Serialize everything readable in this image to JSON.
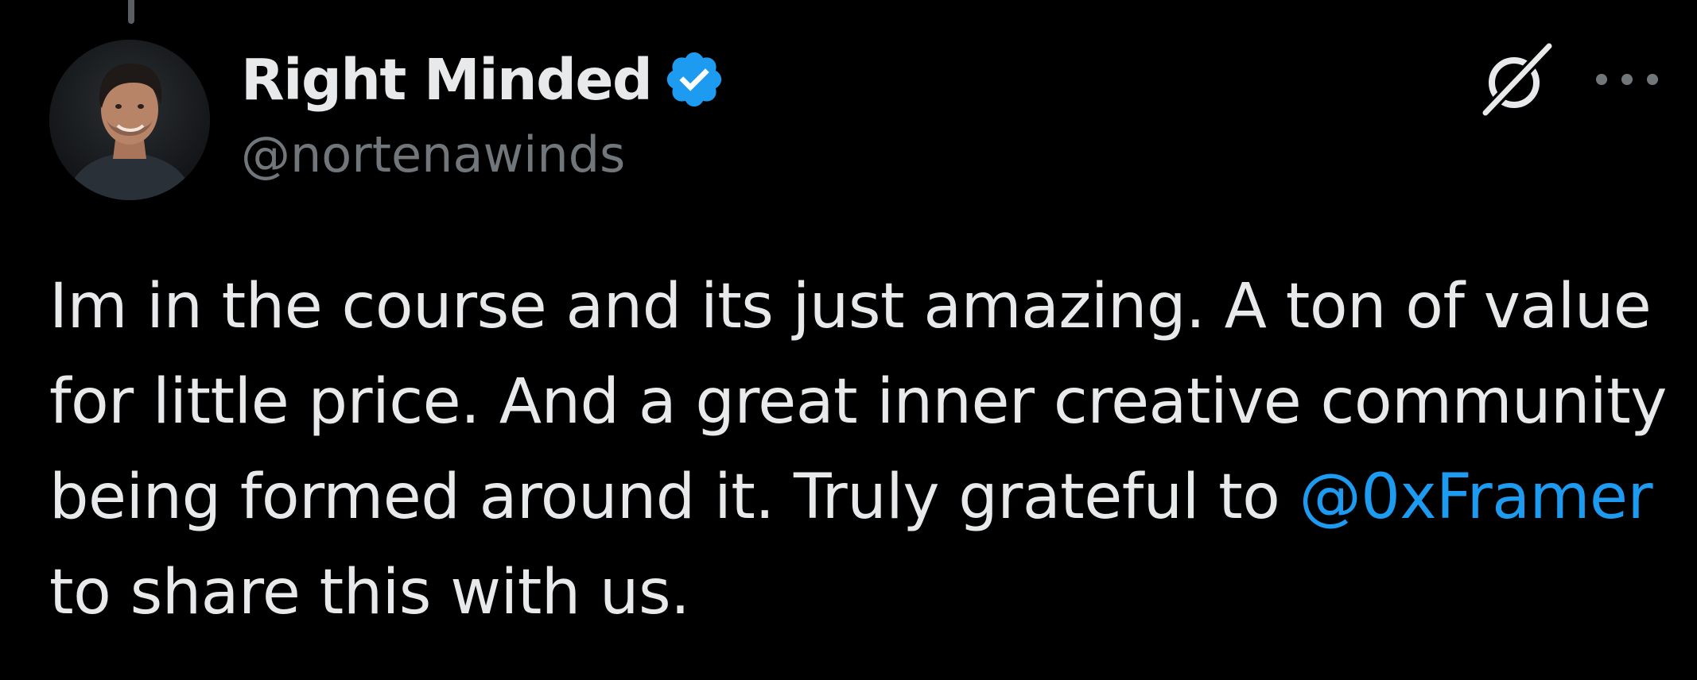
{
  "author": {
    "display_name": "Right Minded",
    "handle": "@nortenawinds",
    "verified": true,
    "verified_badge_color": "#1d9bf0"
  },
  "actions": {
    "grok_icon": "grok-icon",
    "more_icon": "more-options-icon"
  },
  "tweet": {
    "line1": "Im in the course and its just amazing. A ton of value",
    "line2": "for little price. And a great inner creative community",
    "line3_prefix": "being formed around it. Truly grateful to ",
    "mention": "@0xFramer",
    "line4": "to share this with us."
  },
  "colors": {
    "background": "#000000",
    "text": "#e7e9ea",
    "secondary_text": "#71767b",
    "link": "#1d9bf0"
  }
}
